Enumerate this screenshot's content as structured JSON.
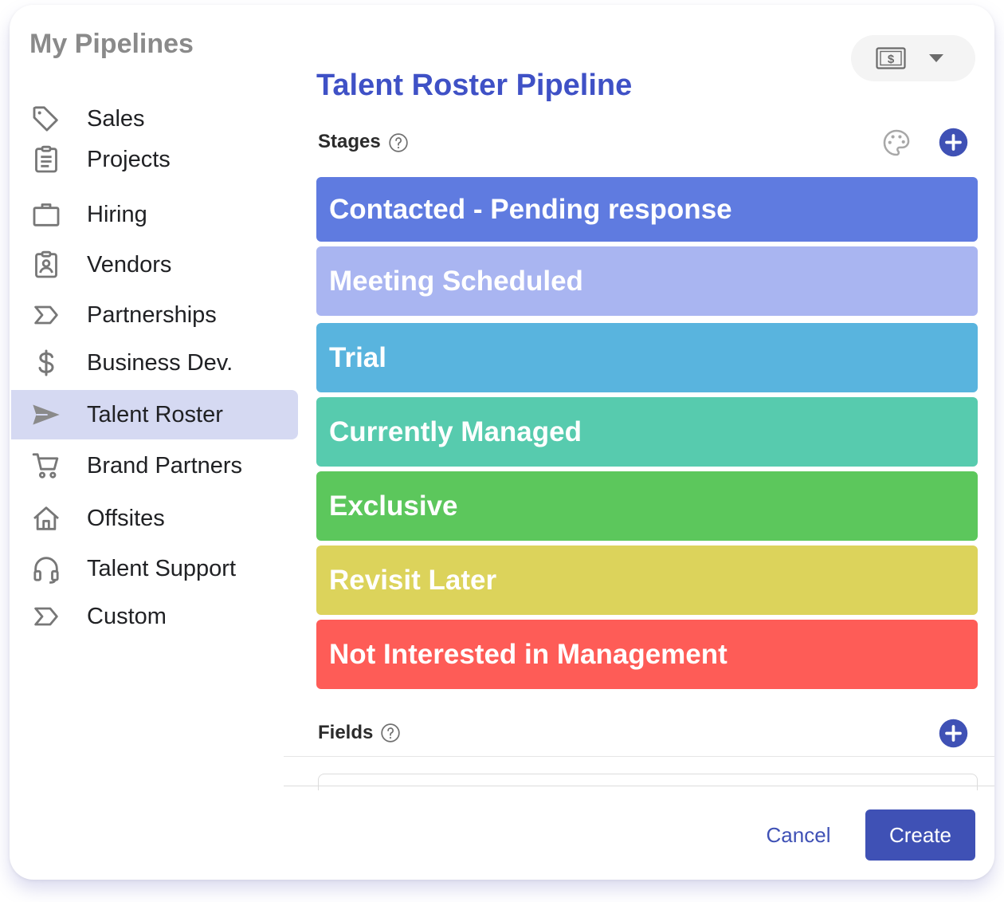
{
  "sidebar": {
    "title": "My Pipelines",
    "items": [
      {
        "label": "Sales",
        "icon": "tag-icon",
        "active": false
      },
      {
        "label": "Projects",
        "icon": "clipboard-icon",
        "active": false
      },
      {
        "label": "Hiring",
        "icon": "briefcase-icon",
        "active": false
      },
      {
        "label": "Vendors",
        "icon": "contact-badge-icon",
        "active": false
      },
      {
        "label": "Partnerships",
        "icon": "pipeline-arrow-icon",
        "active": false
      },
      {
        "label": "Business Dev.",
        "icon": "dollar-icon",
        "active": false
      },
      {
        "label": "Talent Roster",
        "icon": "send-icon",
        "active": true
      },
      {
        "label": "Brand Partners",
        "icon": "cart-icon",
        "active": false
      },
      {
        "label": "Offsites",
        "icon": "home-icon",
        "active": false
      },
      {
        "label": "Talent Support",
        "icon": "headset-icon",
        "active": false
      },
      {
        "label": "Custom",
        "icon": "pipeline-arrow-icon",
        "active": false
      }
    ]
  },
  "header": {
    "currency_icon": "currency-icon",
    "dropdown_icon": "caret-down-icon"
  },
  "main": {
    "title": "Talent Roster Pipeline",
    "stages_label": "Stages",
    "fields_label": "Fields",
    "stages": [
      {
        "label": "Contacted - Pending response",
        "color": "#5f7be0"
      },
      {
        "label": "Meeting Scheduled",
        "color": "#a9b5f1"
      },
      {
        "label": "Trial",
        "color": "#59b4de"
      },
      {
        "label": "Currently Managed",
        "color": "#57cbae"
      },
      {
        "label": "Exclusive",
        "color": "#5cc75c"
      },
      {
        "label": "Revisit Later",
        "color": "#dcd35b"
      },
      {
        "label": "Not Interested in Management",
        "color": "#fe5c57"
      }
    ]
  },
  "footer": {
    "cancel_label": "Cancel",
    "create_label": "Create"
  },
  "colors": {
    "accent": "#3f51b5",
    "title": "#3f51c6",
    "active_nav": "#d5d9f2"
  }
}
